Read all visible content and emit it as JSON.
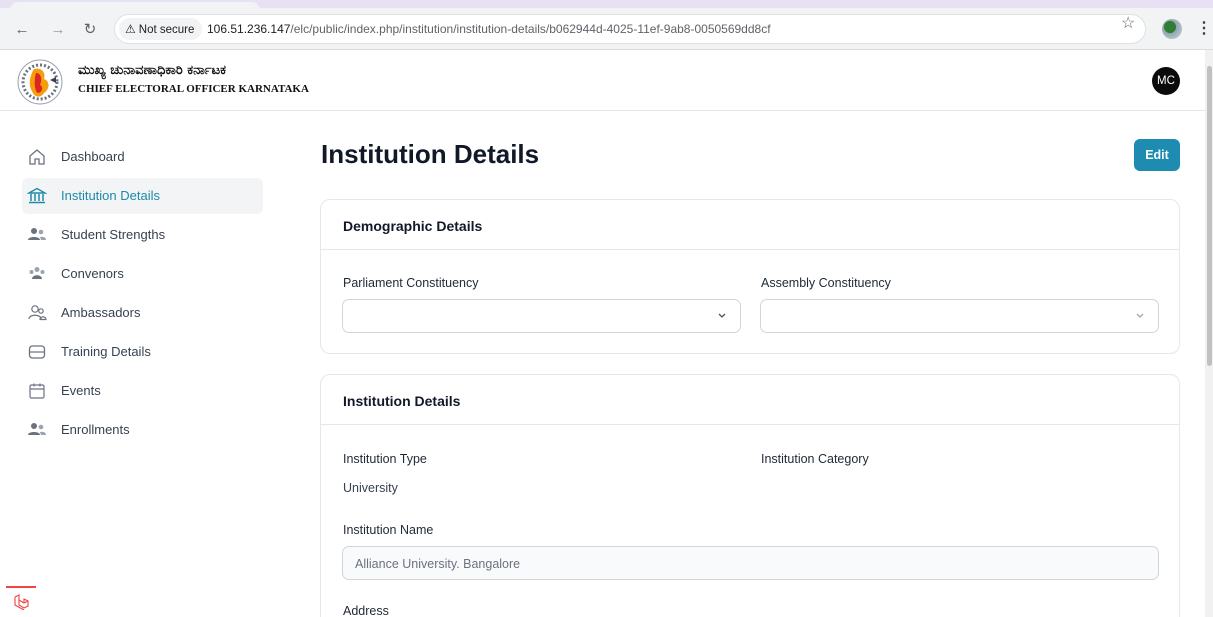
{
  "browser": {
    "security_label": "Not secure",
    "url_host": "106.51.236.147",
    "url_path": "/elc/public/index.php/institution/institution-details/b062944d-4025-11ef-9ab8-0050569dd8cf"
  },
  "header": {
    "logo_kannada": "ಮುಖ್ಯ ಚುನಾವಣಾಧಿಕಾರಿ ಕರ್ನಾಟಕ",
    "logo_english": "CHIEF ELECTORAL OFFICER KARNATAKA",
    "avatar_initials": "MC"
  },
  "sidebar": {
    "items": [
      {
        "label": "Dashboard",
        "icon": "home-icon"
      },
      {
        "label": "Institution Details",
        "icon": "bank-icon"
      },
      {
        "label": "Student Strengths",
        "icon": "users-icon"
      },
      {
        "label": "Convenors",
        "icon": "group-icon"
      },
      {
        "label": "Ambassadors",
        "icon": "user-pair-icon"
      },
      {
        "label": "Training Details",
        "icon": "database-icon"
      },
      {
        "label": "Events",
        "icon": "calendar-icon"
      },
      {
        "label": "Enrollments",
        "icon": "users-icon"
      }
    ],
    "active_index": 1
  },
  "main": {
    "title": "Institution Details",
    "edit_label": "Edit",
    "demographic": {
      "heading": "Demographic Details",
      "parliament_label": "Parliament Constituency",
      "parliament_value": "",
      "assembly_label": "Assembly Constituency",
      "assembly_value": ""
    },
    "institution": {
      "heading": "Institution Details",
      "type_label": "Institution Type",
      "type_value": "University",
      "category_label": "Institution Category",
      "category_value": "",
      "name_label": "Institution Name",
      "name_value": "Alliance University. Bangalore",
      "address_label": "Address"
    }
  },
  "colors": {
    "accent": "#1d8cb0",
    "active_text": "#1e8aa8",
    "debug_bar": "#ef4444"
  }
}
